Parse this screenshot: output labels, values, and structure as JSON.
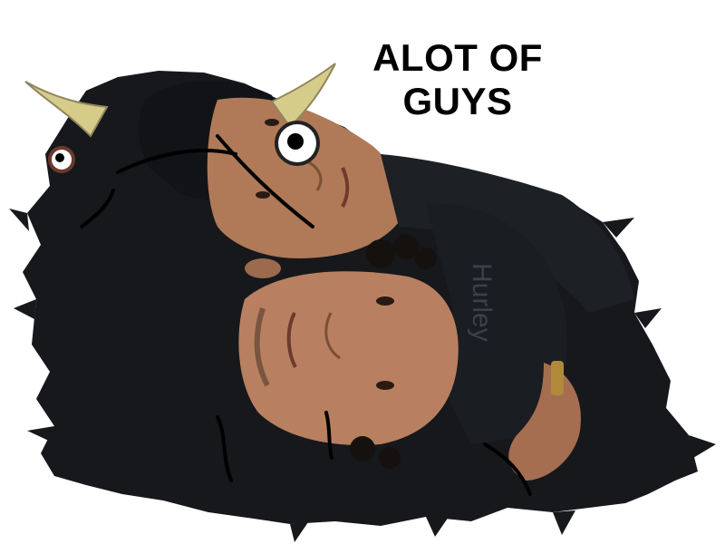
{
  "caption": {
    "line1": "ALOT OF",
    "line2": "GUYS"
  },
  "cap_text": "Hurley",
  "colors": {
    "background": "#ffffff",
    "fur": "#16181c",
    "skin": "#b07a58",
    "horn": "#d6cc8a",
    "text": "#000000"
  }
}
